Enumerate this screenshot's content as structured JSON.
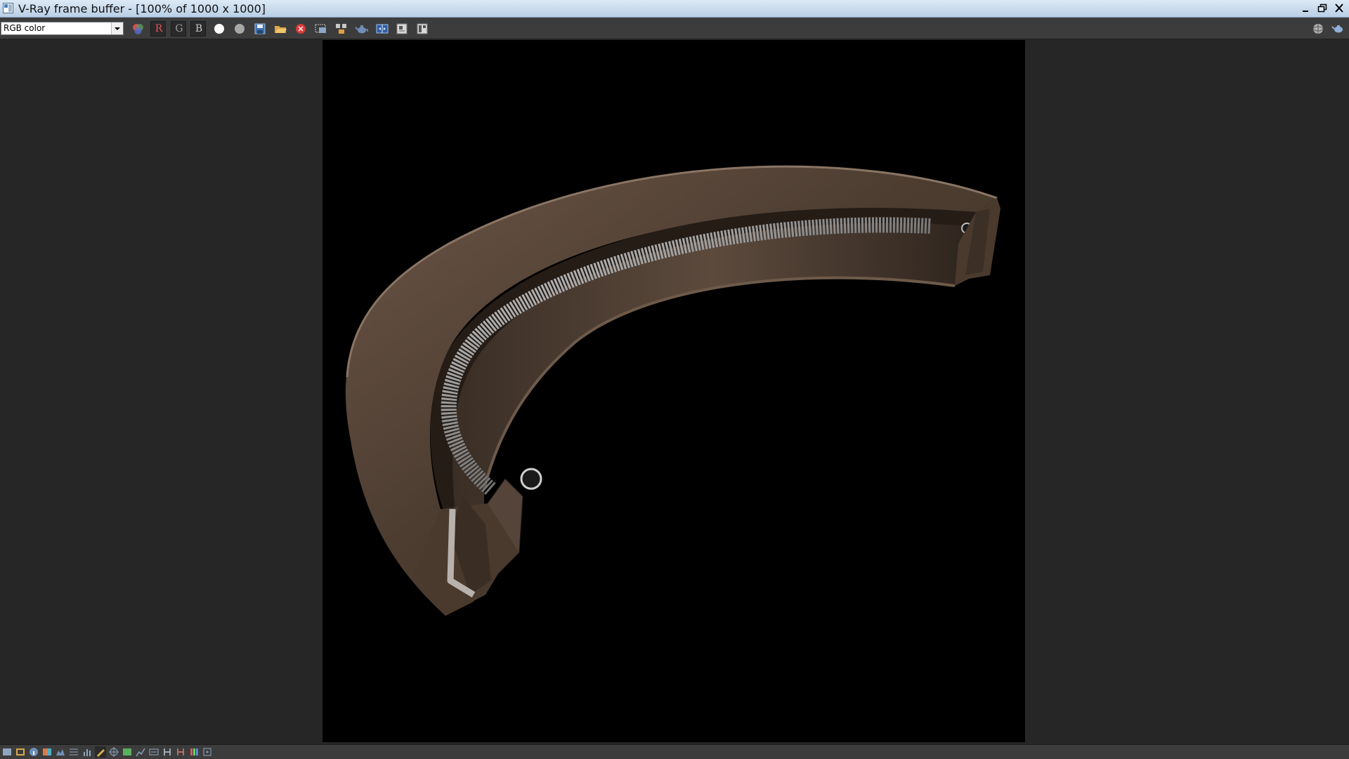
{
  "window": {
    "title": "V-Ray frame buffer - [100% of 1000 x 1000]"
  },
  "toolbar": {
    "channel_select": {
      "value": "RGB color"
    },
    "channel_buttons": [
      {
        "label": "R",
        "color": "#e0505a"
      },
      {
        "label": "G",
        "color": "#9a9a9a"
      },
      {
        "label": "B",
        "color": "#c8c8c8"
      }
    ],
    "icons": [
      "color-correction-icon",
      "channel-r-icon",
      "channel-g-icon",
      "channel-b-icon",
      "white-circle-icon",
      "gray-circle-icon",
      "save-image-icon",
      "open-folder-icon",
      "stop-render-icon",
      "region-render-icon",
      "track-mouse-icon",
      "render-teapot-icon",
      "compare-icon",
      "history-icon",
      "settings-panel-icon",
      "globe-icon",
      "teapot-icon"
    ]
  },
  "statusbar": {
    "icons": [
      "display-correction-icon",
      "srgb-icon",
      "info-icon",
      "lut-icon",
      "levels-icon",
      "curves-icon",
      "histogram-icon",
      "pencil-icon",
      "crosshair-icon",
      "image-icon",
      "graph-icon",
      "stamp-icon",
      "h-icon",
      "h-icon-2",
      "color-bar-icon",
      "zoom-icon"
    ]
  },
  "render": {
    "description_color": "#4a3b30",
    "accent": "#ffffff"
  }
}
